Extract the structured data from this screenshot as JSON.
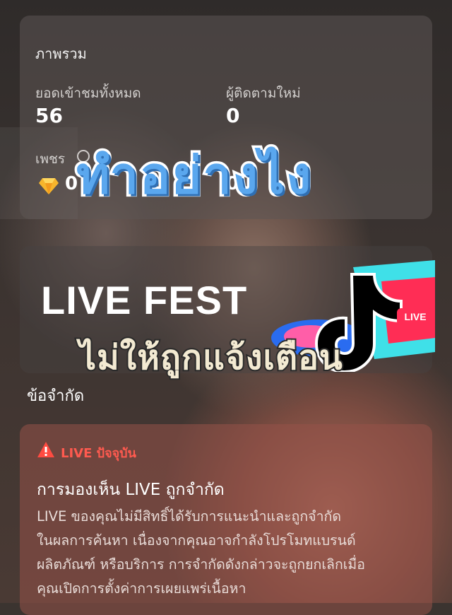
{
  "overview": {
    "title": "ภาพรวม",
    "total_views_label": "ยอดเข้าชมทั้งหมด",
    "total_views_value": "56",
    "new_followers_label": "ผู้ติดตามใหม่",
    "new_followers_value": "0",
    "diamonds_label": "เพชร",
    "diamonds_value": "0",
    "fourth_value": "0",
    "info_icon": "info-icon",
    "diamond_icon": "diamond-icon"
  },
  "stickers": {
    "top": "ทำอย่างไง",
    "middle": "ไม่ให้ถูกแจ้งเตือน"
  },
  "banner": {
    "title": "LIVE FEST",
    "logo_badge": "LIVE",
    "logo_icon": "tiktok-logo"
  },
  "limits": {
    "title": "ข้อจำกัด",
    "status_label": "LIVE ปัจจุบัน",
    "status_icon": "warning-icon",
    "heading": "การมองเห็น LIVE ถูกจำกัด",
    "body_lines": [
      "LIVE ของคุณไม่มีสิทธิ์ได้รับการแนะนำและถูกจำกัด",
      "ในผลการค้นหา เนื่องจากคุณอาจกำลังโปรโมทแบรนด์",
      "ผลิตภัณฑ์ หรือบริการ การจำกัดดังกล่าวจะถูกยกเลิกเมื่อ",
      "คุณเปิดการตั้งค่าการเผยแพร่เนื้อหา"
    ]
  },
  "colors": {
    "warning_red": "#ff5a4f",
    "sticker_blue": "#5aa7ee",
    "card_overlay": "#5c5654"
  }
}
